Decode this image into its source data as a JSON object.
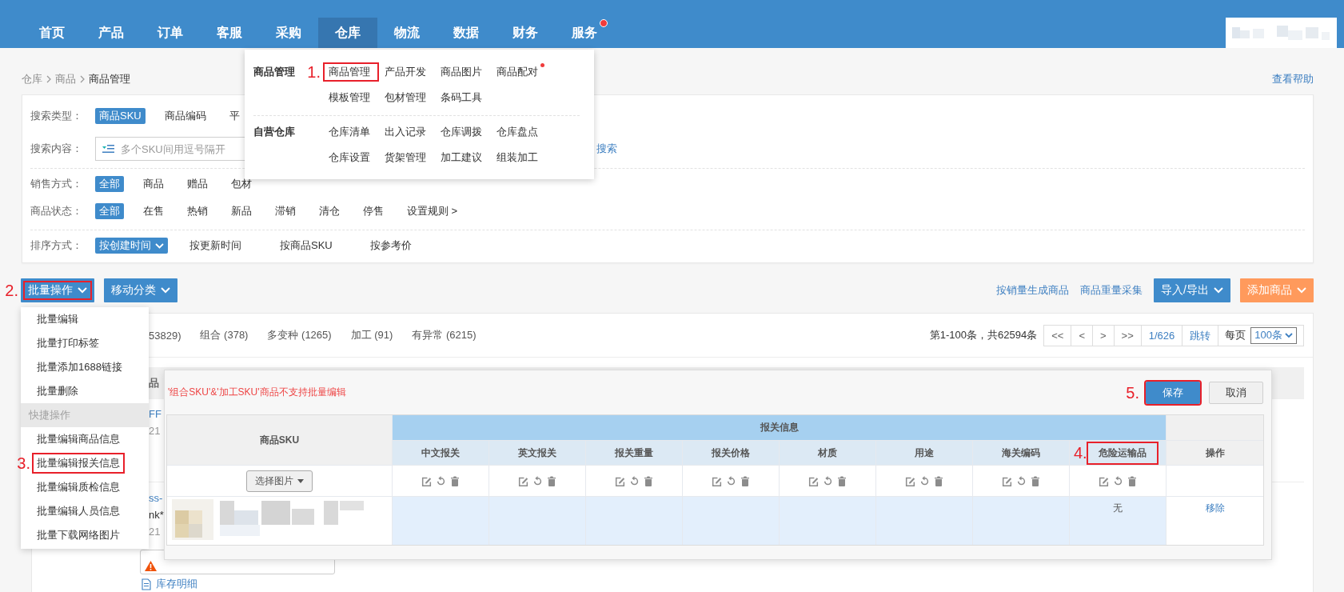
{
  "nav": {
    "items": [
      {
        "label": "首页",
        "selected": false,
        "dot": false
      },
      {
        "label": "产品",
        "selected": false,
        "dot": false
      },
      {
        "label": "订单",
        "selected": false,
        "dot": false
      },
      {
        "label": "客服",
        "selected": false,
        "dot": false
      },
      {
        "label": "采购",
        "selected": false,
        "dot": false
      },
      {
        "label": "仓库",
        "selected": true,
        "dot": false
      },
      {
        "label": "物流",
        "selected": false,
        "dot": false
      },
      {
        "label": "数据",
        "selected": false,
        "dot": false
      },
      {
        "label": "财务",
        "selected": false,
        "dot": false
      },
      {
        "label": "服务",
        "selected": false,
        "dot": true
      }
    ]
  },
  "nav_menu": {
    "groups": [
      {
        "title": "商品管理",
        "rows": [
          [
            {
              "label": "商品管理",
              "dot": false,
              "marker": "1."
            },
            {
              "label": "产品开发",
              "dot": false
            },
            {
              "label": "商品图片",
              "dot": false
            },
            {
              "label": "商品配对",
              "dot": true
            }
          ],
          [
            {
              "label": "模板管理",
              "dot": false
            },
            {
              "label": "包材管理",
              "dot": false
            },
            {
              "label": "条码工具",
              "dot": false
            }
          ]
        ]
      },
      {
        "title": "自营仓库",
        "rows": [
          [
            {
              "label": "仓库清单",
              "dot": false
            },
            {
              "label": "出入记录",
              "dot": false
            },
            {
              "label": "仓库调拨",
              "dot": false
            },
            {
              "label": "仓库盘点",
              "dot": false
            }
          ],
          [
            {
              "label": "仓库设置",
              "dot": false
            },
            {
              "label": "货架管理",
              "dot": false
            },
            {
              "label": "加工建议",
              "dot": false
            },
            {
              "label": "组装加工",
              "dot": false
            }
          ]
        ]
      }
    ]
  },
  "breadcrumb": [
    "仓库",
    "商品",
    "商品管理"
  ],
  "help_link": "查看帮助",
  "filters": [
    {
      "kind": "tags",
      "label": "搜索类型：",
      "options": [
        {
          "label": "商品SKU",
          "selected": true
        },
        {
          "label": "商品编码",
          "selected": false
        },
        {
          "label": "平",
          "selected": false
        }
      ]
    },
    {
      "kind": "search",
      "label": "搜索内容：",
      "placeholder": "多个SKU间用逗号隔开",
      "action": "搜索"
    },
    {
      "kind": "divider"
    },
    {
      "kind": "tags",
      "label": "销售方式：",
      "options": [
        {
          "label": "全部",
          "selected": true
        },
        {
          "label": "商品",
          "selected": false
        },
        {
          "label": "赠品",
          "selected": false
        },
        {
          "label": "包材",
          "selected": false
        }
      ]
    },
    {
      "kind": "tags",
      "label": "商品状态：",
      "options": [
        {
          "label": "全部",
          "selected": true
        },
        {
          "label": "在售",
          "selected": false
        },
        {
          "label": "热销",
          "selected": false
        },
        {
          "label": "新品",
          "selected": false
        },
        {
          "label": "滞销",
          "selected": false
        },
        {
          "label": "清仓",
          "selected": false
        },
        {
          "label": "停售",
          "selected": false
        },
        {
          "label": "设置规则 >",
          "selected": false
        }
      ]
    },
    {
      "kind": "divider"
    },
    {
      "kind": "sort",
      "label": "排序方式：",
      "options": [
        {
          "label": "按创建时间",
          "selected": true,
          "dropdown": true
        },
        {
          "label": "按更新时间",
          "selected": false,
          "dropdown": false
        },
        {
          "label": "按商品SKU",
          "selected": false,
          "dropdown": false
        },
        {
          "label": "按参考价",
          "selected": false,
          "dropdown": false
        }
      ]
    }
  ],
  "toolbar": {
    "left": [
      {
        "label": "批量操作",
        "dropdown": true,
        "marker": "2."
      },
      {
        "label": "移动分类",
        "dropdown": true
      }
    ],
    "links": [
      "按销量生成商品",
      "商品重量采集"
    ],
    "right": [
      {
        "label": "导入/导出",
        "kind": "primary",
        "dropdown": true
      },
      {
        "label": "添加商品",
        "kind": "accent",
        "dropdown": true
      }
    ]
  },
  "batch_menu": {
    "items": [
      {
        "label": "批量编辑",
        "kind": "item"
      },
      {
        "label": "批量打印标签",
        "kind": "item"
      },
      {
        "label": "批量添加1688链接",
        "kind": "item"
      },
      {
        "label": "批量删除",
        "kind": "item"
      },
      {
        "label": "快捷操作",
        "kind": "header"
      },
      {
        "label": "批量编辑商品信息",
        "kind": "item"
      },
      {
        "label": "批量编辑报关信息",
        "kind": "item",
        "marker": "3."
      },
      {
        "label": "批量编辑质检信息",
        "kind": "item"
      },
      {
        "label": "批量编辑人员信息",
        "kind": "item"
      },
      {
        "label": "批量下载网络图片",
        "kind": "item"
      }
    ]
  },
  "list": {
    "tabs": [
      "53829)",
      "组合 (378)",
      "多变种 (1265)",
      "加工 (91)",
      "有异常 (6215)"
    ],
    "pagination": {
      "summary": "第1-100条，共62594条",
      "buttons": [
        {
          "label": "<<",
          "kind": "nav"
        },
        {
          "label": "<",
          "kind": "nav"
        },
        {
          "label": ">",
          "kind": "nav"
        },
        {
          "label": ">>",
          "kind": "nav"
        },
        {
          "label": "1/626",
          "kind": "link"
        },
        {
          "label": "跳转",
          "kind": "link"
        }
      ],
      "per_page_label": "每页",
      "per_page": "100条"
    },
    "header": "品",
    "rows": [
      {
        "lines": [
          {
            "text": "FF",
            "kind": "link"
          },
          {
            "text": "21",
            "kind": "meta"
          }
        ]
      },
      {
        "lines": [
          {
            "text": "ss-",
            "kind": "link"
          },
          {
            "text": "nk*",
            "kind": "text"
          },
          {
            "text": "21",
            "kind": "meta"
          }
        ]
      }
    ],
    "stock_link": "库存明细"
  },
  "modal": {
    "notice": "'组合SKU'&'加工SKU'商品不支持批量编辑",
    "buttons": [
      {
        "label": "保存",
        "kind": "primary",
        "marker": "5."
      },
      {
        "label": "取消",
        "kind": "default"
      }
    ],
    "table": {
      "sku_header": "商品SKU",
      "group_header": "报关信息",
      "action_header": "操作",
      "picker": "选择图片",
      "columns": [
        {
          "label": "中文报关"
        },
        {
          "label": "英文报关"
        },
        {
          "label": "报关重量"
        },
        {
          "label": "报关价格"
        },
        {
          "label": "材质"
        },
        {
          "label": "用途"
        },
        {
          "label": "海关编码"
        },
        {
          "label": "危险运输品",
          "marker": "4."
        }
      ],
      "rows": [
        {
          "cells": [
            null,
            null,
            null,
            null,
            null,
            null,
            null,
            "无"
          ],
          "action": "移除"
        }
      ]
    }
  }
}
